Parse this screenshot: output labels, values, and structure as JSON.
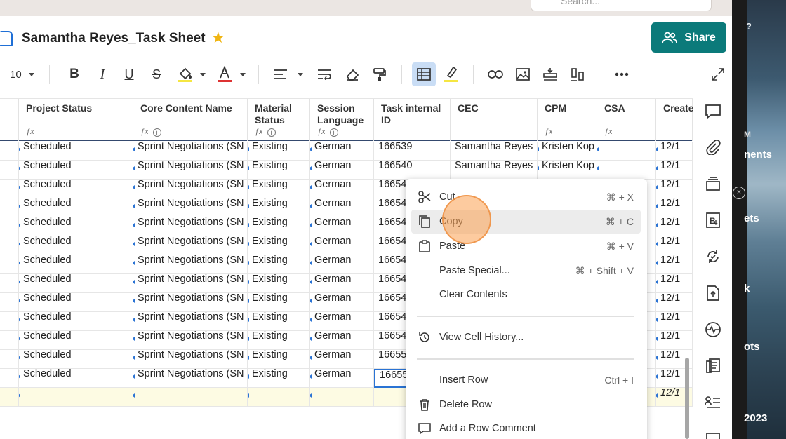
{
  "search": {
    "placeholder": "Search..."
  },
  "sheet": {
    "title": "Samantha Reyes_Task Sheet"
  },
  "share_button": {
    "label": "Share"
  },
  "toolbar": {
    "font_size": "10"
  },
  "columns": [
    {
      "label": "Project Status",
      "icons": "fx"
    },
    {
      "label": "Core Content Name",
      "icons": "fx-info"
    },
    {
      "label": "Material Status",
      "icons": "fx-info"
    },
    {
      "label": "Session Language",
      "icons": "fx-info"
    },
    {
      "label": "Task internal ID",
      "icons": ""
    },
    {
      "label": "CEC",
      "icons": ""
    },
    {
      "label": "CPM",
      "icons": "fx"
    },
    {
      "label": "CSA",
      "icons": "fx"
    },
    {
      "label": "Create",
      "icons": ""
    }
  ],
  "rows": [
    [
      "Scheduled",
      "Sprint Negotiations (SN",
      "Existing",
      "German",
      "166539",
      "Samantha Reyes",
      "Kristen Kop",
      "",
      "12/1"
    ],
    [
      "Scheduled",
      "Sprint Negotiations (SN",
      "Existing",
      "German",
      "166540",
      "Samantha Reyes",
      "Kristen Kop",
      "",
      "12/1"
    ],
    [
      "Scheduled",
      "Sprint Negotiations (SN",
      "Existing",
      "German",
      "16654",
      "",
      "",
      "",
      "12/1"
    ],
    [
      "Scheduled",
      "Sprint Negotiations (SN",
      "Existing",
      "German",
      "16654",
      "",
      "",
      "",
      "12/1"
    ],
    [
      "Scheduled",
      "Sprint Negotiations (SN",
      "Existing",
      "German",
      "16654",
      "",
      "",
      "",
      "12/1"
    ],
    [
      "Scheduled",
      "Sprint Negotiations (SN",
      "Existing",
      "German",
      "16654",
      "",
      "",
      "",
      "12/1"
    ],
    [
      "Scheduled",
      "Sprint Negotiations (SN",
      "Existing",
      "German",
      "16654",
      "",
      "",
      "",
      "12/1"
    ],
    [
      "Scheduled",
      "Sprint Negotiations (SN",
      "Existing",
      "German",
      "16654",
      "",
      "",
      "",
      "12/1"
    ],
    [
      "Scheduled",
      "Sprint Negotiations (SN",
      "Existing",
      "German",
      "16654",
      "",
      "",
      "",
      "12/1"
    ],
    [
      "Scheduled",
      "Sprint Negotiations (SN",
      "Existing",
      "German",
      "16654",
      "",
      "",
      "",
      "12/1"
    ],
    [
      "Scheduled",
      "Sprint Negotiations (SN",
      "Existing",
      "German",
      "16654",
      "",
      "",
      "",
      "12/1"
    ],
    [
      "Scheduled",
      "Sprint Negotiations (SN",
      "Existing",
      "German",
      "16655",
      "",
      "",
      "",
      "12/1"
    ],
    [
      "Scheduled",
      "Sprint Negotiations (SN",
      "Existing",
      "German",
      "16655",
      "",
      "",
      "",
      "12/1"
    ],
    [
      "",
      "",
      "",
      "",
      "",
      "",
      "",
      "",
      "12/1"
    ]
  ],
  "context_menu": {
    "cut": {
      "label": "Cut",
      "shortcut": "⌘ + X"
    },
    "copy": {
      "label": "Copy",
      "shortcut": "⌘ + C"
    },
    "paste": {
      "label": "Paste",
      "shortcut": "⌘ + V"
    },
    "paste_special": {
      "label": "Paste Special...",
      "shortcut": "⌘ + Shift + V"
    },
    "clear_contents": {
      "label": "Clear Contents"
    },
    "view_cell_history": {
      "label": "View Cell History..."
    },
    "insert_row": {
      "label": "Insert Row",
      "shortcut": "Ctrl + I"
    },
    "delete_row": {
      "label": "Delete Row"
    },
    "add_row_comment": {
      "label": "Add a Row Comment"
    }
  },
  "desktop": {
    "text1": "nents",
    "text2": "ets",
    "text3": "k",
    "text4": "ots",
    "text5": "2023"
  },
  "colors": {
    "share": "#0b7a7a",
    "accent_blue": "#2a73d4",
    "star": "#f0b512",
    "header_rule": "#34496e"
  }
}
